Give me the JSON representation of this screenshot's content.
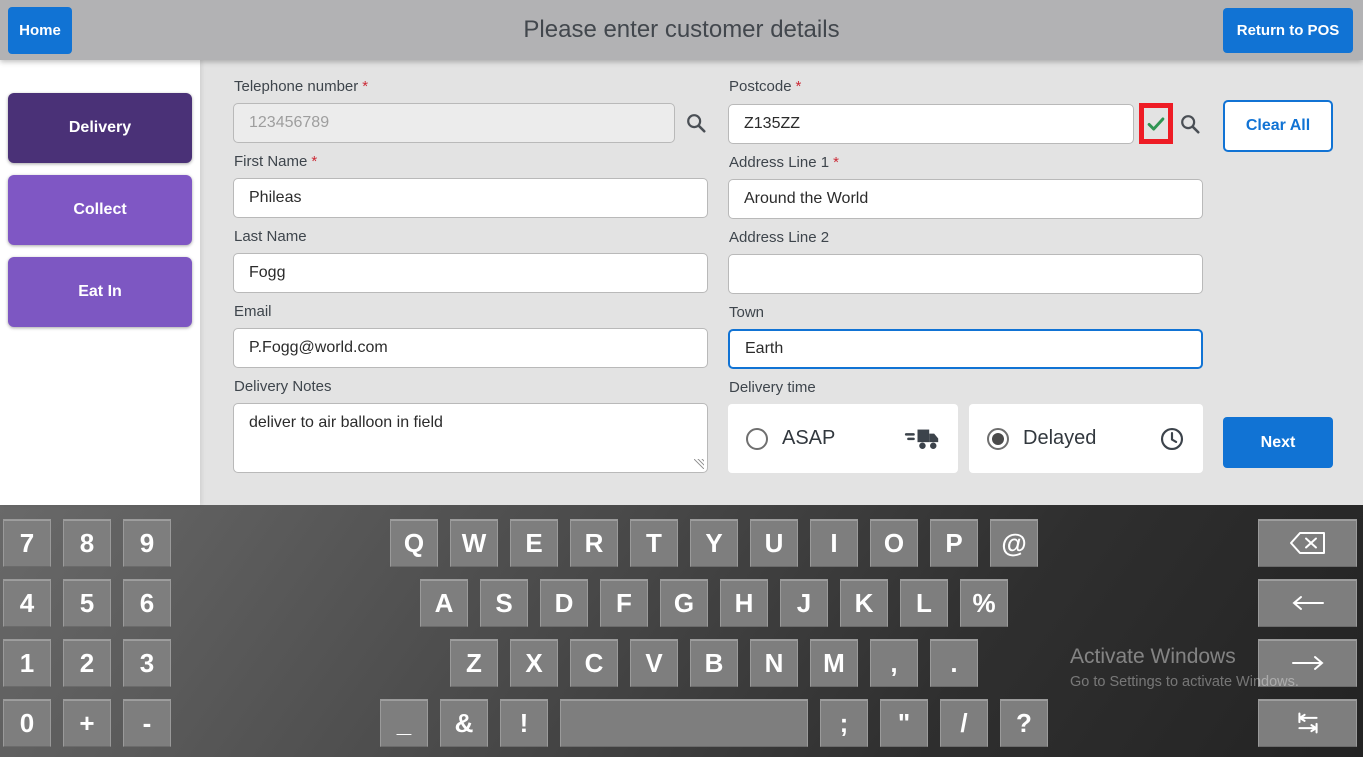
{
  "header": {
    "home_label": "Home",
    "title": "Please enter customer details",
    "return_label": "Return to POS"
  },
  "sidebar": {
    "items": [
      {
        "label": "Delivery",
        "active": true
      },
      {
        "label": "Collect",
        "active": false
      },
      {
        "label": "Eat In",
        "active": false
      }
    ]
  },
  "form": {
    "required_marker": "*",
    "telephone": {
      "label": "Telephone number",
      "required": true,
      "value": "123456789",
      "icon": "search-icon"
    },
    "first_name": {
      "label": "First Name",
      "required": true,
      "value": "Phileas"
    },
    "last_name": {
      "label": "Last Name",
      "required": false,
      "value": "Fogg"
    },
    "email": {
      "label": "Email",
      "required": false,
      "value": "P.Fogg@world.com"
    },
    "delivery_notes": {
      "label": "Delivery Notes",
      "required": false,
      "value": "deliver to air balloon in field"
    },
    "postcode": {
      "label": "Postcode",
      "required": true,
      "value": "Z135ZZ",
      "valid_icon": "check-icon",
      "valid_highlight": "red-box-annotation",
      "icon": "search-icon"
    },
    "address1": {
      "label": "Address Line 1",
      "required": true,
      "value": "Around the World"
    },
    "address2": {
      "label": "Address Line 2",
      "required": false,
      "value": ""
    },
    "town": {
      "label": "Town",
      "required": false,
      "value": "Earth",
      "focused": true
    },
    "delivery_time": {
      "label": "Delivery time",
      "asap": {
        "label": "ASAP",
        "selected": false,
        "icon": "truck-icon"
      },
      "delayed": {
        "label": "Delayed",
        "selected": true,
        "icon": "clock-icon"
      }
    },
    "clear_all_label": "Clear All",
    "next_label": "Next"
  },
  "keyboard": {
    "numpad": [
      "7",
      "8",
      "9",
      "4",
      "5",
      "6",
      "1",
      "2",
      "3",
      "0",
      "+",
      "-"
    ],
    "row1": [
      "Q",
      "W",
      "E",
      "R",
      "T",
      "Y",
      "U",
      "I",
      "O",
      "P",
      "@"
    ],
    "row2": [
      "A",
      "S",
      "D",
      "F",
      "G",
      "H",
      "J",
      "K",
      "L",
      "%"
    ],
    "row3": [
      "Z",
      "X",
      "C",
      "V",
      "B",
      "N",
      "M",
      ",",
      "."
    ],
    "row4_left": [
      "_",
      "&",
      "!"
    ],
    "row4_right": [
      ";",
      "\"",
      "/",
      "?"
    ],
    "space_key": "",
    "special_keys": [
      "backspace-icon",
      "arrow-left-icon",
      "arrow-right-icon",
      "tab-icon"
    ]
  },
  "watermark": {
    "line1": "Activate Windows",
    "line2": "Go to Settings to activate Windows."
  },
  "colors": {
    "accent_blue": "#1173d4",
    "purple_dark": "#4a3177",
    "purple_light": "#7f57c4",
    "check_green": "#2f9553",
    "highlight_red": "#ee1c25",
    "header_gray": "#b2b2b4"
  }
}
